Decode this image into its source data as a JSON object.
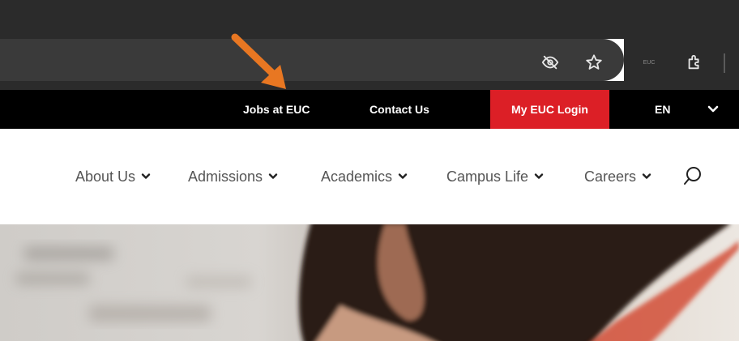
{
  "browser": {
    "icons": [
      "eye-slash-icon",
      "star-icon",
      "extensions-icon"
    ],
    "extension_badge": "EUC"
  },
  "topbar": {
    "jobs": "Jobs at EUC",
    "contact": "Contact Us",
    "login": "My EUC Login",
    "language": "EN"
  },
  "nav": {
    "items": [
      {
        "label": "About Us"
      },
      {
        "label": "Admissions"
      },
      {
        "label": "Academics"
      },
      {
        "label": "Campus Life"
      },
      {
        "label": "Careers"
      }
    ]
  },
  "colors": {
    "topbar_bg": "#000000",
    "login_bg": "#dc1f26",
    "nav_text": "#555555",
    "annotation_arrow": "#e87722"
  }
}
